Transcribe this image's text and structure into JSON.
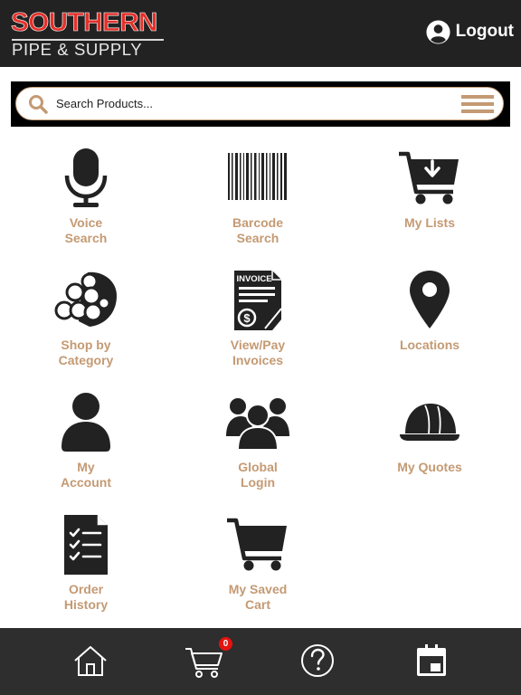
{
  "header": {
    "logo_top": "SOUTHERN",
    "logo_bottom": "PIPE & SUPPLY",
    "logout_label": "Logout"
  },
  "search": {
    "placeholder": "Search Products..."
  },
  "menu": {
    "voice": "Voice\nSearch",
    "barcode": "Barcode\nSearch",
    "lists": "My Lists",
    "category": "Shop by\nCategory",
    "invoices": "View/Pay\nInvoices",
    "locations": "Locations",
    "account": "My\nAccount",
    "global_login": "Global\nLogin",
    "quotes": "My Quotes",
    "order_history": "Order\nHistory",
    "saved_cart": "My Saved\nCart"
  },
  "icons": {
    "invoice_text": "INVOICE",
    "invoice_symbol": "$"
  },
  "footer": {
    "cart_count": "0"
  },
  "colors": {
    "brand_red": "#e4312b",
    "accent_tan": "#c49a73",
    "header_bg": "#222222",
    "footer_bg": "#2e2e2e"
  }
}
